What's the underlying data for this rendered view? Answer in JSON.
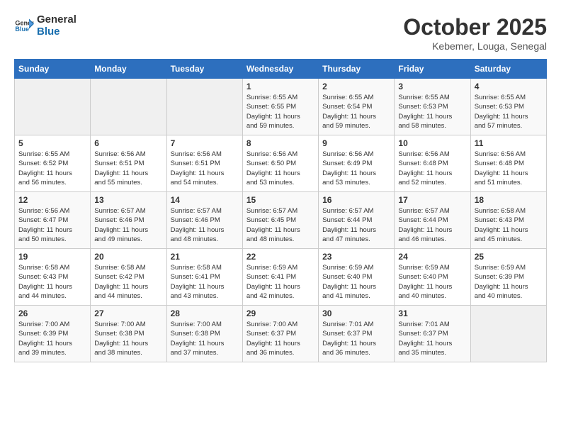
{
  "logo": {
    "line1": "General",
    "line2": "Blue"
  },
  "title": "October 2025",
  "subtitle": "Kebemer, Louga, Senegal",
  "weekdays": [
    "Sunday",
    "Monday",
    "Tuesday",
    "Wednesday",
    "Thursday",
    "Friday",
    "Saturday"
  ],
  "weeks": [
    [
      {
        "day": "",
        "info": ""
      },
      {
        "day": "",
        "info": ""
      },
      {
        "day": "",
        "info": ""
      },
      {
        "day": "1",
        "info": "Sunrise: 6:55 AM\nSunset: 6:55 PM\nDaylight: 11 hours\nand 59 minutes."
      },
      {
        "day": "2",
        "info": "Sunrise: 6:55 AM\nSunset: 6:54 PM\nDaylight: 11 hours\nand 59 minutes."
      },
      {
        "day": "3",
        "info": "Sunrise: 6:55 AM\nSunset: 6:53 PM\nDaylight: 11 hours\nand 58 minutes."
      },
      {
        "day": "4",
        "info": "Sunrise: 6:55 AM\nSunset: 6:53 PM\nDaylight: 11 hours\nand 57 minutes."
      }
    ],
    [
      {
        "day": "5",
        "info": "Sunrise: 6:55 AM\nSunset: 6:52 PM\nDaylight: 11 hours\nand 56 minutes."
      },
      {
        "day": "6",
        "info": "Sunrise: 6:56 AM\nSunset: 6:51 PM\nDaylight: 11 hours\nand 55 minutes."
      },
      {
        "day": "7",
        "info": "Sunrise: 6:56 AM\nSunset: 6:51 PM\nDaylight: 11 hours\nand 54 minutes."
      },
      {
        "day": "8",
        "info": "Sunrise: 6:56 AM\nSunset: 6:50 PM\nDaylight: 11 hours\nand 53 minutes."
      },
      {
        "day": "9",
        "info": "Sunrise: 6:56 AM\nSunset: 6:49 PM\nDaylight: 11 hours\nand 53 minutes."
      },
      {
        "day": "10",
        "info": "Sunrise: 6:56 AM\nSunset: 6:48 PM\nDaylight: 11 hours\nand 52 minutes."
      },
      {
        "day": "11",
        "info": "Sunrise: 6:56 AM\nSunset: 6:48 PM\nDaylight: 11 hours\nand 51 minutes."
      }
    ],
    [
      {
        "day": "12",
        "info": "Sunrise: 6:56 AM\nSunset: 6:47 PM\nDaylight: 11 hours\nand 50 minutes."
      },
      {
        "day": "13",
        "info": "Sunrise: 6:57 AM\nSunset: 6:46 PM\nDaylight: 11 hours\nand 49 minutes."
      },
      {
        "day": "14",
        "info": "Sunrise: 6:57 AM\nSunset: 6:46 PM\nDaylight: 11 hours\nand 48 minutes."
      },
      {
        "day": "15",
        "info": "Sunrise: 6:57 AM\nSunset: 6:45 PM\nDaylight: 11 hours\nand 48 minutes."
      },
      {
        "day": "16",
        "info": "Sunrise: 6:57 AM\nSunset: 6:44 PM\nDaylight: 11 hours\nand 47 minutes."
      },
      {
        "day": "17",
        "info": "Sunrise: 6:57 AM\nSunset: 6:44 PM\nDaylight: 11 hours\nand 46 minutes."
      },
      {
        "day": "18",
        "info": "Sunrise: 6:58 AM\nSunset: 6:43 PM\nDaylight: 11 hours\nand 45 minutes."
      }
    ],
    [
      {
        "day": "19",
        "info": "Sunrise: 6:58 AM\nSunset: 6:43 PM\nDaylight: 11 hours\nand 44 minutes."
      },
      {
        "day": "20",
        "info": "Sunrise: 6:58 AM\nSunset: 6:42 PM\nDaylight: 11 hours\nand 44 minutes."
      },
      {
        "day": "21",
        "info": "Sunrise: 6:58 AM\nSunset: 6:41 PM\nDaylight: 11 hours\nand 43 minutes."
      },
      {
        "day": "22",
        "info": "Sunrise: 6:59 AM\nSunset: 6:41 PM\nDaylight: 11 hours\nand 42 minutes."
      },
      {
        "day": "23",
        "info": "Sunrise: 6:59 AM\nSunset: 6:40 PM\nDaylight: 11 hours\nand 41 minutes."
      },
      {
        "day": "24",
        "info": "Sunrise: 6:59 AM\nSunset: 6:40 PM\nDaylight: 11 hours\nand 40 minutes."
      },
      {
        "day": "25",
        "info": "Sunrise: 6:59 AM\nSunset: 6:39 PM\nDaylight: 11 hours\nand 40 minutes."
      }
    ],
    [
      {
        "day": "26",
        "info": "Sunrise: 7:00 AM\nSunset: 6:39 PM\nDaylight: 11 hours\nand 39 minutes."
      },
      {
        "day": "27",
        "info": "Sunrise: 7:00 AM\nSunset: 6:38 PM\nDaylight: 11 hours\nand 38 minutes."
      },
      {
        "day": "28",
        "info": "Sunrise: 7:00 AM\nSunset: 6:38 PM\nDaylight: 11 hours\nand 37 minutes."
      },
      {
        "day": "29",
        "info": "Sunrise: 7:00 AM\nSunset: 6:37 PM\nDaylight: 11 hours\nand 36 minutes."
      },
      {
        "day": "30",
        "info": "Sunrise: 7:01 AM\nSunset: 6:37 PM\nDaylight: 11 hours\nand 36 minutes."
      },
      {
        "day": "31",
        "info": "Sunrise: 7:01 AM\nSunset: 6:37 PM\nDaylight: 11 hours\nand 35 minutes."
      },
      {
        "day": "",
        "info": ""
      }
    ]
  ]
}
